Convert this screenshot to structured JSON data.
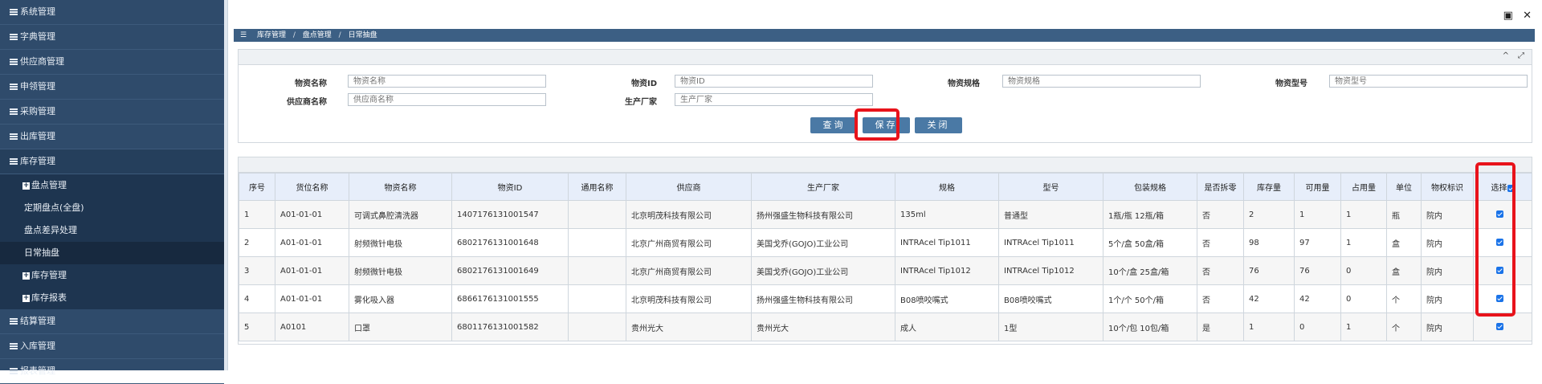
{
  "sidebar": {
    "items": [
      {
        "label": "系统管理"
      },
      {
        "label": "字典管理"
      },
      {
        "label": "供应商管理"
      },
      {
        "label": "申领管理"
      },
      {
        "label": "采购管理"
      },
      {
        "label": "出库管理"
      },
      {
        "label": "库存管理"
      }
    ],
    "inventory_sub": {
      "pandian": "盘点管理",
      "pandian_children": [
        "定期盘点(全盘)",
        "盘点差异处理",
        "日常抽盘"
      ],
      "kucun": "库存管理",
      "report": "库存报表"
    },
    "bottom_items": [
      {
        "label": "结算管理"
      },
      {
        "label": "入库管理"
      },
      {
        "label": "报表管理"
      }
    ]
  },
  "window": {
    "restore_icon": "restore-icon",
    "close_icon": "close-icon",
    "close_glyph": "✕"
  },
  "breadcrumb": {
    "menu_glyph": "☰",
    "items": [
      "库存管理",
      "盘点管理",
      "日常抽盘"
    ],
    "sep": "/"
  },
  "panel_tools": {
    "collapse": "^",
    "expand": "⤢"
  },
  "search": {
    "material_name": {
      "label": "物资名称",
      "placeholder": "物资名称"
    },
    "material_id": {
      "label": "物资ID",
      "placeholder": "物资ID"
    },
    "spec": {
      "label": "物资规格",
      "placeholder": "物资规格"
    },
    "model": {
      "label": "物资型号",
      "placeholder": "物资型号"
    },
    "supplier": {
      "label": "供应商名称",
      "placeholder": "供应商名称"
    },
    "manufacturer": {
      "label": "生产厂家",
      "placeholder": "生产厂家"
    }
  },
  "buttons": {
    "query": "查询",
    "save": "保存",
    "close": "关闭"
  },
  "table": {
    "headers": [
      "序号",
      "货位名称",
      "物资名称",
      "物资ID",
      "通用名称",
      "供应商",
      "生产厂家",
      "规格",
      "型号",
      "包装规格",
      "是否拆零",
      "库存量",
      "可用量",
      "占用量",
      "单位",
      "物权标识",
      "选择"
    ],
    "rows": [
      [
        "1",
        "A01-01-01",
        "可调式鼻腔清洗器",
        "1407176131001547",
        "",
        "北京明茂科技有限公司",
        "扬州强盛生物科技有限公司",
        "135ml",
        "普通型",
        "1瓶/瓶 12瓶/箱",
        "否",
        "2",
        "1",
        "1",
        "瓶",
        "院内"
      ],
      [
        "2",
        "A01-01-01",
        "射频微针电极",
        "6802176131001648",
        "",
        "北京广州商贸有限公司",
        "美国戈乔(GOJO)工业公司",
        "INTRAcel Tip1011",
        "INTRAcel Tip1011",
        "5个/盒 50盒/箱",
        "否",
        "98",
        "97",
        "1",
        "盒",
        "院内"
      ],
      [
        "3",
        "A01-01-01",
        "射频微针电极",
        "6802176131001649",
        "",
        "北京广州商贸有限公司",
        "美国戈乔(GOJO)工业公司",
        "INTRAcel Tip1012",
        "INTRAcel Tip1012",
        "10个/盒 25盒/箱",
        "否",
        "76",
        "76",
        "0",
        "盒",
        "院内"
      ],
      [
        "4",
        "A01-01-01",
        "雾化吸入器",
        "6866176131001555",
        "",
        "北京明茂科技有限公司",
        "扬州强盛生物科技有限公司",
        "B08喷咬嘴式",
        "B08喷咬嘴式",
        "1个/个 50个/箱",
        "否",
        "42",
        "42",
        "0",
        "个",
        "院内"
      ],
      [
        "5",
        "A0101",
        "口罩",
        "6801176131001582",
        "",
        "贵州光大",
        "贵州光大",
        "成人",
        "1型",
        "10个/包 10包/箱",
        "是",
        "1",
        "0",
        "1",
        "个",
        "院内"
      ]
    ]
  },
  "colors": {
    "sidebar_bg": "#2f4b6b",
    "header_bg": "#3c5f84",
    "button_bg": "#4a79a5",
    "highlight": "#e8131b",
    "checkbox": "#1a73e8"
  }
}
